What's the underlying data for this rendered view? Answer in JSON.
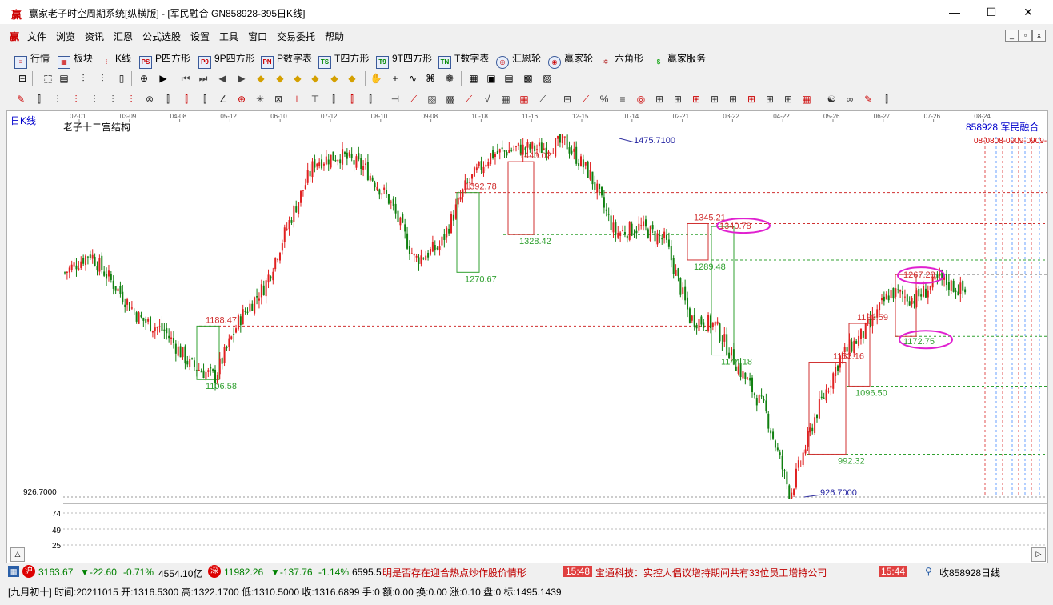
{
  "window": {
    "app_icon": "赢",
    "title": "赢家老子时空周期系统[纵横版] - [军民融合   GN858928-395日K线]",
    "minimize": "—",
    "maximize": "☐",
    "close": "✕"
  },
  "menu": {
    "logo": "赢",
    "items": [
      "文件",
      "浏览",
      "资讯",
      "汇恩",
      "公式选股",
      "设置",
      "工具",
      "窗口",
      "交易委托",
      "帮助"
    ]
  },
  "toolbar1": {
    "items": [
      {
        "icon": "grid-icon",
        "label": "行情"
      },
      {
        "icon": "blocks-icon",
        "label": "板块"
      },
      {
        "icon": "kline-icon",
        "label": "K线"
      },
      {
        "icon": "p-square-icon",
        "label": "P四方形"
      },
      {
        "icon": "9p-square-icon",
        "label": "9P四方形"
      },
      {
        "icon": "p-table-icon",
        "label": "P数字表"
      },
      {
        "icon": "t-square-icon",
        "label": "T四方形"
      },
      {
        "icon": "9t-square-icon",
        "label": "9T四方形"
      },
      {
        "icon": "t-table-icon",
        "label": "T数字表"
      },
      {
        "icon": "huien-wheel-icon",
        "label": "汇恩轮"
      },
      {
        "icon": "winner-wheel-icon",
        "label": "赢家轮"
      },
      {
        "icon": "hexagram-icon",
        "label": "六角形"
      },
      {
        "icon": "dollar-icon",
        "label": "赢家服务"
      }
    ]
  },
  "chart": {
    "period_label": "日K线",
    "study_name": "老子十二宫结构",
    "stock_info": "858928  军民融合",
    "future_dates_label": "08-0808-0909-0909-09",
    "date_ticks": [
      "02-01",
      "03-09",
      "04-08",
      "05-12",
      "06-10",
      "07-12",
      "08-10",
      "09-08",
      "10-18",
      "11-16",
      "12-15",
      "01-14",
      "02-21",
      "03-22",
      "04-22",
      "05-26",
      "06-27",
      "07-26",
      "08-24"
    ],
    "y_axis_label": "926.7000",
    "volume_ticks": [
      "74",
      "49",
      "25"
    ],
    "level_labels": {
      "high": "1475.7100",
      "low": "926.7000",
      "l1": "1392.78",
      "l2": "1440.02",
      "l3": "1328.42",
      "l4": "1270.67",
      "l5": "1188.47",
      "l6": "1106.58",
      "l7": "1345.21",
      "l8": "1340.78",
      "l9": "1289.48",
      "l10": "1144.18",
      "l11": "1267.28",
      "l12": "1172.75",
      "l13": "1192.59",
      "l14": "1133.16",
      "l15": "1096.50",
      "l16": "992.32"
    },
    "scroll_up": "△"
  },
  "status": {
    "sh_value": "3163.67",
    "sh_change": "▼-22.60",
    "sh_pct": "-0.71%",
    "sh_amount": "4554.10亿",
    "sz_value": "11982.26",
    "sz_change": "▼-137.76",
    "sz_pct": "-1.14%",
    "sz_amount": "6595.5",
    "ticker1": "明是否存在迎合热点炒作股价情形",
    "time1": "15:48",
    "ticker2": "宝通科技：实控人倡议增持期间共有33位员工增持公司",
    "time2": "15:44",
    "code_info": "收858928日线"
  },
  "bottom": {
    "text": "[九月初十] 时间:20211015 开:1316.5300 高:1322.1700 低:1310.5000 收:1316.6899 手:0 额:0.00 换:0.00 涨:0.10 盘:0 标:1495.1439"
  },
  "chart_data": {
    "type": "candlestick",
    "title": "老子十二宫结构",
    "series_name": "军民融合 858928 日K线",
    "x_range": [
      "02-01",
      "08-24"
    ],
    "y_range": [
      926.7,
      1475.71
    ],
    "annotated_levels": [
      1475.71,
      1440.02,
      1392.78,
      1345.21,
      1340.78,
      1328.42,
      1289.48,
      1270.67,
      1267.28,
      1192.59,
      1188.47,
      1172.75,
      1144.18,
      1133.16,
      1106.58,
      1096.5,
      992.32,
      926.7
    ],
    "approx_path": [
      [
        "02-01",
        1270
      ],
      [
        "02-10",
        1300
      ],
      [
        "03-01",
        1250
      ],
      [
        "03-09",
        1200
      ],
      [
        "04-08",
        1180
      ],
      [
        "05-12",
        1130
      ],
      [
        "05-20",
        1110
      ],
      [
        "06-10",
        1200
      ],
      [
        "07-12",
        1250
      ],
      [
        "07-30",
        1350
      ],
      [
        "08-10",
        1440
      ],
      [
        "08-20",
        1450
      ],
      [
        "09-08",
        1430
      ],
      [
        "09-20",
        1380
      ],
      [
        "10-10",
        1290
      ],
      [
        "10-18",
        1310
      ],
      [
        "11-16",
        1400
      ],
      [
        "11-25",
        1450
      ],
      [
        "12-15",
        1460
      ],
      [
        "01-05",
        1460
      ],
      [
        "01-14",
        1470
      ],
      [
        "01-25",
        1420
      ],
      [
        "02-05",
        1330
      ],
      [
        "02-21",
        1340
      ],
      [
        "03-01",
        1320
      ],
      [
        "03-10",
        1200
      ],
      [
        "03-22",
        1190
      ],
      [
        "04-10",
        1120
      ],
      [
        "04-22",
        1060
      ],
      [
        "04-28",
        930
      ],
      [
        "05-05",
        1050
      ],
      [
        "05-26",
        1140
      ],
      [
        "06-10",
        1180
      ],
      [
        "06-27",
        1240
      ],
      [
        "07-10",
        1230
      ],
      [
        "07-26",
        1260
      ],
      [
        "08-02",
        1240
      ]
    ]
  }
}
